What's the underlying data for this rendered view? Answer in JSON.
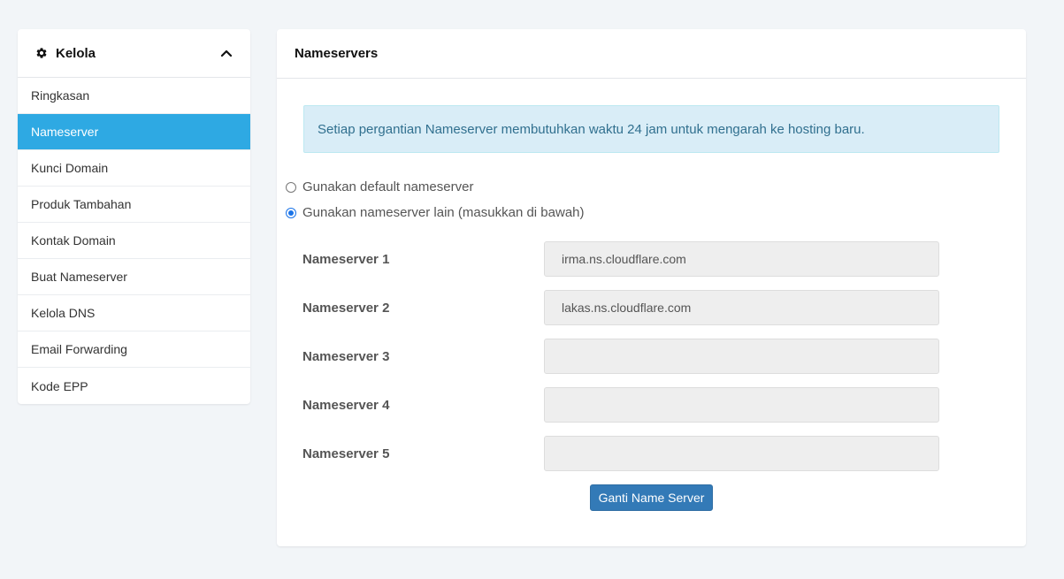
{
  "sidebar": {
    "title": "Kelola",
    "items": [
      {
        "label": "Ringkasan"
      },
      {
        "label": "Nameserver"
      },
      {
        "label": "Kunci Domain"
      },
      {
        "label": "Produk Tambahan"
      },
      {
        "label": "Kontak Domain"
      },
      {
        "label": "Buat Nameserver"
      },
      {
        "label": "Kelola DNS"
      },
      {
        "label": "Email Forwarding"
      },
      {
        "label": "Kode EPP"
      }
    ],
    "active_item": "Nameserver"
  },
  "panel": {
    "title": "Nameservers",
    "alert": "Setiap pergantian Nameserver membutuhkan waktu 24 jam untuk mengarah ke hosting baru.",
    "options": [
      {
        "label": "Gunakan default nameserver",
        "checked": false
      },
      {
        "label": "Gunakan nameserver lain (masukkan di bawah)",
        "checked": true
      }
    ],
    "nameservers": [
      {
        "label": "Nameserver 1",
        "value": "irma.ns.cloudflare.com"
      },
      {
        "label": "Nameserver 2",
        "value": "lakas.ns.cloudflare.com"
      },
      {
        "label": "Nameserver 3",
        "value": ""
      },
      {
        "label": "Nameserver 4",
        "value": ""
      },
      {
        "label": "Nameserver 5",
        "value": ""
      }
    ],
    "submit_label": "Ganti Name Server"
  },
  "colors": {
    "accent": "#2ea9e3",
    "button": "#337ab7",
    "alert_bg": "#d9edf7",
    "alert_text": "#31708f"
  },
  "icons": {
    "header": "gear-icon",
    "collapse": "chevron-up-icon"
  }
}
